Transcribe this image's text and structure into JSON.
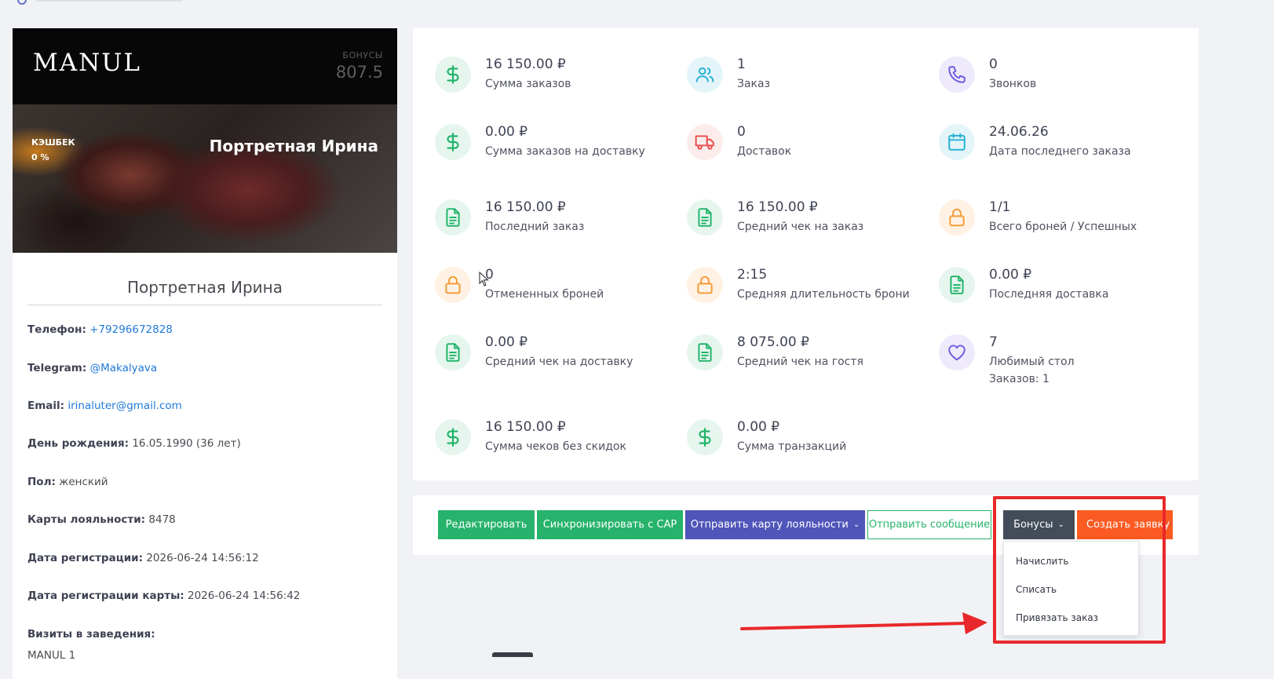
{
  "card": {
    "logo": "MANUL",
    "bonus_label": "БОНУСЫ",
    "bonus_value": "807.5",
    "cashback_label": "КЭШБЕК",
    "cashback_value": "0 %",
    "name": "Портретная Ирина"
  },
  "profile": {
    "name": "Портретная Ирина",
    "phone_label": "Телефон:",
    "phone_value": "+79296672828",
    "telegram_label": "Telegram:",
    "telegram_value": "@Makalyava",
    "email_label": "Email:",
    "email_value": "irinaluter@gmail.com",
    "birthday_label": "День рождения:",
    "birthday_value": "16.05.1990 (36 лет)",
    "gender_label": "Пол:",
    "gender_value": "женский",
    "cards_label": "Карты лояльности:",
    "cards_value": "8478",
    "reg_date_label": "Дата регистрации:",
    "reg_date_value": "2026-06-24 14:56:12",
    "card_reg_label": "Дата регистрации карты:",
    "card_reg_value": "2026-06-24 14:56:42",
    "visits_label": "Визиты в заведения:",
    "visits_first": "MANUL 1"
  },
  "stats": [
    {
      "value": "16 150.00 ₽",
      "label": "Сумма заказов",
      "icon": "dollar-icon",
      "color": "green"
    },
    {
      "value": "1",
      "label": "Заказ",
      "icon": "users-icon",
      "color": "cyan"
    },
    {
      "value": "0",
      "label": "Звонков",
      "icon": "phone-icon",
      "color": "purple"
    },
    {
      "value": "0.00 ₽",
      "label": "Сумма заказов на доставку",
      "icon": "dollar-icon",
      "color": "green"
    },
    {
      "value": "0",
      "label": "Доставок",
      "icon": "truck-icon",
      "color": "red"
    },
    {
      "value": "24.06.26",
      "label": "Дата последнего заказа",
      "icon": "calendar-icon",
      "color": "cyan"
    },
    {
      "value": "16 150.00 ₽",
      "label": "Последний заказ",
      "icon": "document-icon",
      "color": "green"
    },
    {
      "value": "16 150.00 ₽",
      "label": "Средний чек на заказ",
      "icon": "document-icon",
      "color": "green"
    },
    {
      "value": "1/1",
      "label": "Всего броней / Успешных",
      "icon": "lock-icon",
      "color": "orange"
    },
    {
      "value": "0",
      "label": "Отмененных броней",
      "icon": "lock-icon",
      "color": "orange"
    },
    {
      "value": "2:15",
      "label": "Средняя длительность брони",
      "icon": "lock-icon",
      "color": "orange"
    },
    {
      "value": "0.00 ₽",
      "label": "Последняя доставка",
      "icon": "document-icon",
      "color": "green"
    },
    {
      "value": "0.00 ₽",
      "label": "Средний чек на доставку",
      "icon": "document-icon",
      "color": "green"
    },
    {
      "value": "8 075.00 ₽",
      "label": "Средний чек на гостя",
      "icon": "document-icon",
      "color": "green"
    },
    {
      "value": "7",
      "label": "Любимый стол",
      "sub": "Заказов: 1",
      "icon": "heart-icon",
      "color": "purple"
    },
    {
      "value": "16 150.00 ₽",
      "label": "Сумма чеков без скидок",
      "icon": "dollar-icon",
      "color": "green"
    },
    {
      "value": "0.00 ₽",
      "label": "Сумма транзакций",
      "icon": "dollar-icon",
      "color": "green"
    }
  ],
  "actions": {
    "edit": "Редактировать",
    "sync": "Синхронизировать с CAP",
    "send_card": "Отправить карту лояльности",
    "send_message": "Отправить сообщение",
    "bonuses": "Бонусы",
    "create_request": "Создать заявку"
  },
  "bonus_menu": {
    "accrue": "Начислить",
    "write_off": "Списать",
    "link_order": "Привязать заказ"
  },
  "colors": {
    "green": "#27b36b",
    "indigo": "#4f55b9",
    "dark": "#424d59",
    "orange": "#fb5a22",
    "annotation_red": "#e8282a",
    "link": "#1f79d8"
  }
}
